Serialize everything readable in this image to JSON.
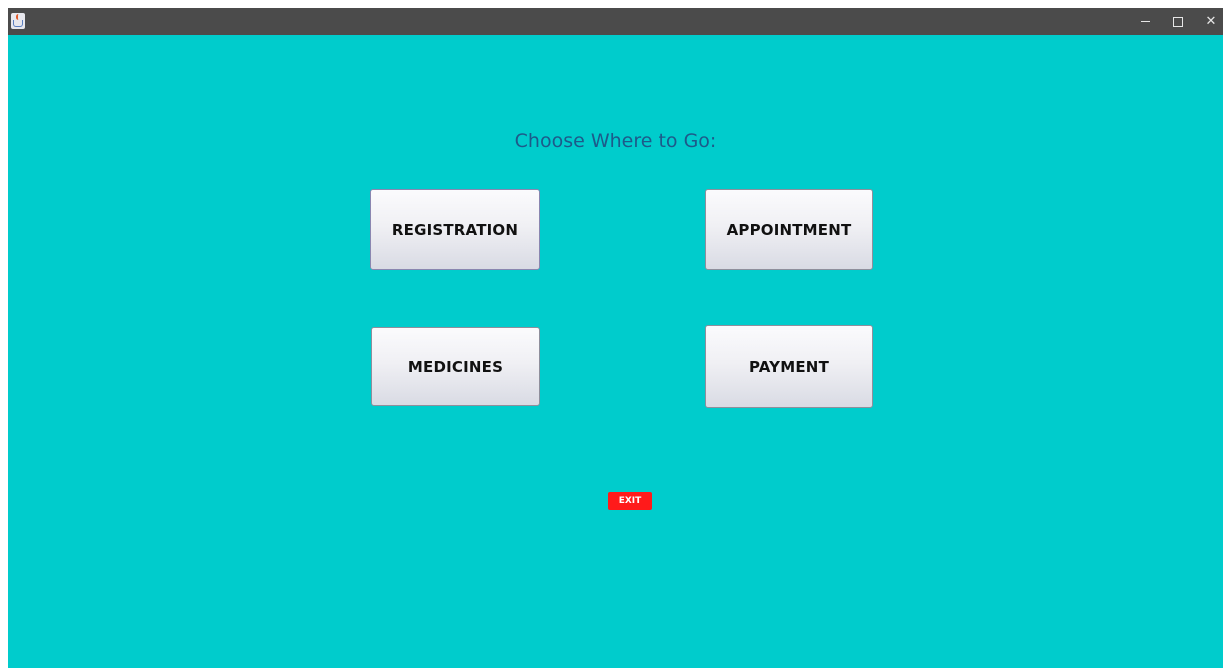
{
  "window": {
    "controls": {
      "minimize": "–",
      "close": "✕"
    },
    "background_color": "#00cccc",
    "titlebar_color": "#4b4b4b",
    "app_icon": "java-cup-icon"
  },
  "main": {
    "heading": "Choose Where to Go:",
    "heading_color": "#1d5a8a",
    "buttons": {
      "registration": "REGISTRATION",
      "appointment": "APPOINTMENT",
      "medicines": "MEDICINES",
      "payment": "PAYMENT"
    },
    "exit": {
      "label": "EXIT",
      "color": "#ff1a1a"
    }
  }
}
